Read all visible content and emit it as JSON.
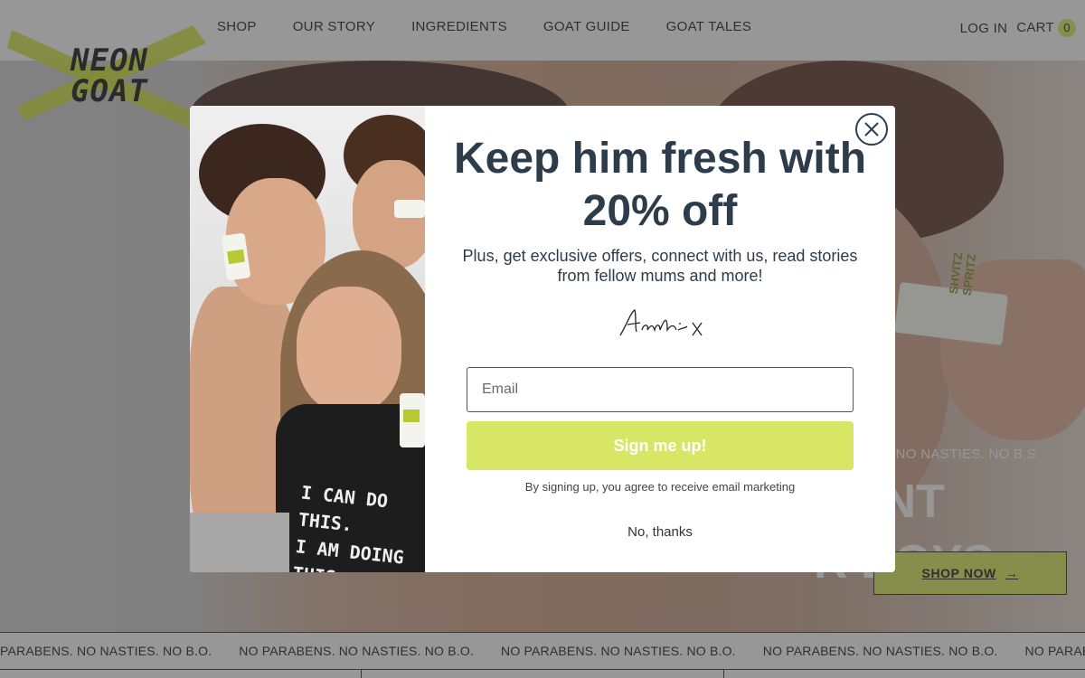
{
  "brand": {
    "logo_text": "NEON\nGOAT",
    "accent": "#cfe05a"
  },
  "nav": {
    "items": [
      "SHOP",
      "OUR STORY",
      "INGREDIENTS",
      "GOAT GUIDE",
      "GOAT TALES"
    ],
    "login": "LOG IN",
    "cart_label": "CART",
    "cart_count": "0"
  },
  "hero": {
    "tagline": "ENS. NO NASTIES. NO B.S",
    "line1": "ORANT",
    "line2": "R BOYS.",
    "cta": "SHOP NOW",
    "product_label": "SHVITZ SPRITZ"
  },
  "ticker": {
    "items": [
      "PARABENS. NO NASTIES. NO B.O.",
      "NO PARABENS. NO NASTIES. NO B.O.",
      "NO PARABENS. NO NASTIES. NO B.O.",
      "NO PARABENS. NO NASTIES. NO B.O.",
      "NO PARABENS. NO NASTIES. NO B.O."
    ]
  },
  "modal": {
    "headline": "Keep him fresh with 20% off",
    "subtext": "Plus, get exclusive offers, connect with us, read stories from fellow mums and more!",
    "signature": "Aaakie x",
    "email_placeholder": "Email",
    "signup_label": "Sign me up!",
    "disclaimer": "By signing up, you agree to receive email marketing",
    "decline_label": "No, thanks",
    "photo_shirt_text": "I CAN DO THIS.\nI AM DOING THIS.",
    "button_color": "#d7e665",
    "heading_color": "#2d3c4a"
  }
}
